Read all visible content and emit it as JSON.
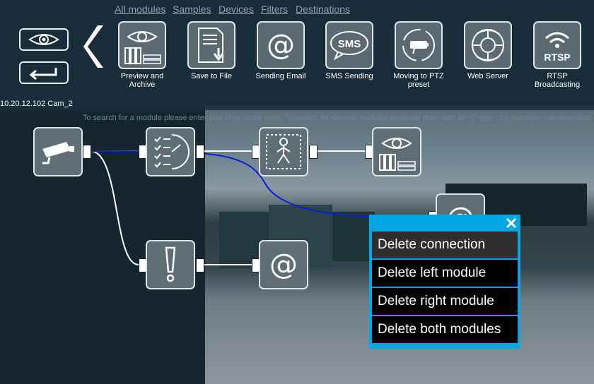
{
  "tabs": [
    {
      "label": "All modules",
      "active": true
    },
    {
      "label": "Samples",
      "active": false
    },
    {
      "label": "Devices",
      "active": false
    },
    {
      "label": "Filters",
      "active": false
    },
    {
      "label": "Destinations",
      "active": false
    }
  ],
  "palette": [
    {
      "label": "Preview and Archive",
      "icon": "eye-archive-icon"
    },
    {
      "label": "Save to File",
      "icon": "save-file-icon"
    },
    {
      "label": "Sending Email",
      "icon": "at-sign-icon"
    },
    {
      "label": "SMS Sending",
      "icon": "sms-bubble-icon"
    },
    {
      "label": "Moving to PTZ preset",
      "icon": "ptz-camera-icon"
    },
    {
      "label": "Web Server",
      "icon": "web-globe-icon"
    },
    {
      "label": "RTSP Broadcasting",
      "icon": "rtsp-wifi-icon"
    }
  ],
  "camera_name": "10.20.12.102 Cam_2",
  "search_hint": "To search for a module please enter part of its name here. To search for several modules separate them with an \"|\" sign , for example: camera|micro",
  "rtsp_text": "RTSP",
  "sms_text": "SMS",
  "at_text": "@",
  "context_menu": {
    "items": [
      "Delete connection",
      "Delete left module",
      "Delete right module",
      "Delete both modules"
    ],
    "hovered_index": 0
  },
  "colors": {
    "accent": "#00a8e3",
    "selected_wire": "#0a1fd6",
    "wire": "#ffffff"
  }
}
